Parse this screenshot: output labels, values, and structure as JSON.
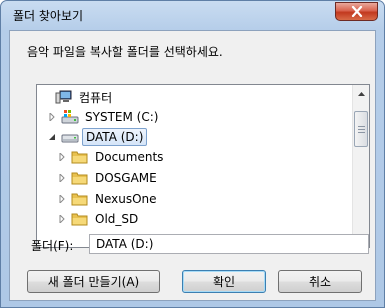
{
  "window": {
    "title": "폴더 찾아보기"
  },
  "dialog": {
    "prompt": "음악 파일을 복사할 폴더를 선택하세요.",
    "tree": [
      {
        "label": "컴퓨터",
        "icon": "computer-icon",
        "expander": "none",
        "level": 0
      },
      {
        "label": "SYSTEM (C:)",
        "icon": "system-drive-icon",
        "expander": "collapsed",
        "level": 1
      },
      {
        "label": "DATA (D:)",
        "icon": "drive-icon",
        "expander": "expanded",
        "level": 1,
        "selected": true
      },
      {
        "label": "Documents",
        "icon": "folder-icon",
        "expander": "collapsed",
        "level": 2
      },
      {
        "label": "DOSGAME",
        "icon": "folder-icon",
        "expander": "collapsed",
        "level": 2
      },
      {
        "label": "NexusOne",
        "icon": "folder-icon",
        "expander": "collapsed",
        "level": 2
      },
      {
        "label": "Old_SD",
        "icon": "folder-icon",
        "expander": "collapsed",
        "level": 2
      }
    ],
    "folder_label": "폴더(F):",
    "folder_value": "DATA (D:)",
    "buttons": {
      "new_folder": "새 폴더 만들기(A)",
      "ok": "확인",
      "cancel": "취소"
    }
  },
  "colors": {
    "selection": "#d5e5f8",
    "default_button_border": "#3c7fb1",
    "close_button": "#c2391f"
  }
}
